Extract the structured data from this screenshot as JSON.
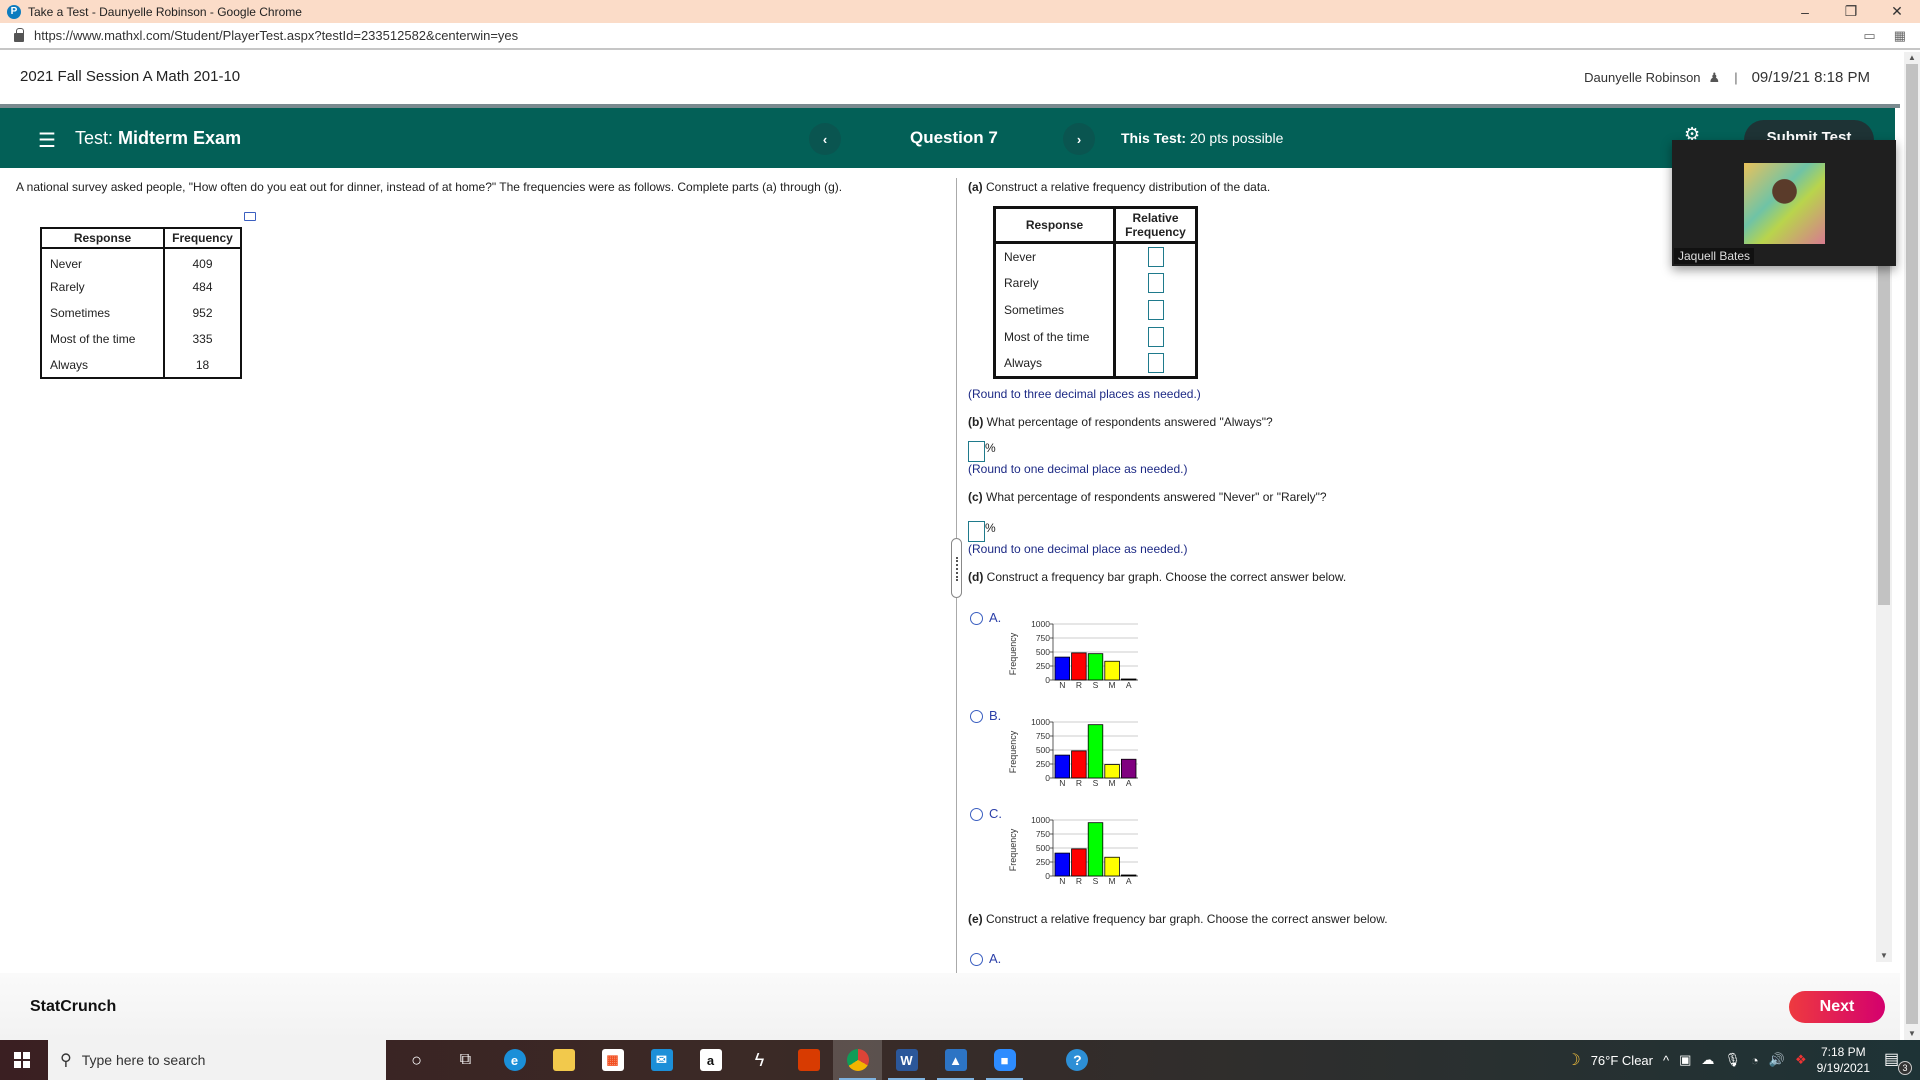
{
  "browser": {
    "window_title": "Take a Test - Daunyelle Robinson - Google Chrome",
    "url": "https://www.mathxl.com/Student/PlayerTest.aspx?testId=233512582&centerwin=yes",
    "controls": {
      "minimize": "–",
      "restore": "❐",
      "close": "✕"
    }
  },
  "header": {
    "course_title": "2021 Fall Session A Math 201-10",
    "user_name": "Daunyelle Robinson",
    "separator": "|",
    "datetime": "09/19/21 8:18 PM"
  },
  "testbar": {
    "menu_icon": "☰",
    "test_label": "Test:",
    "test_name": "Midterm Exam",
    "prev_icon": "‹",
    "question_label": "Question 7",
    "next_icon": "›",
    "points_label": "This Test:",
    "points_value": "20 pts possible",
    "settings_icon": "⚙",
    "submit_label": "Submit Test"
  },
  "problem": {
    "intro": "A national survey asked people, \"How often do you eat out for dinner, instead of at home?\" The frequencies were as follows. Complete parts (a) through (g).",
    "table": {
      "headers": [
        "Response",
        "Frequency"
      ],
      "rows": [
        {
          "response": "Never",
          "frequency": "409"
        },
        {
          "response": "Rarely",
          "frequency": "484"
        },
        {
          "response": "Sometimes",
          "frequency": "952"
        },
        {
          "response": "Most of the time",
          "frequency": "335"
        },
        {
          "response": "Always",
          "frequency": "18"
        }
      ]
    }
  },
  "parts": {
    "a": {
      "label": "(a)",
      "text": "Construct a relative frequency distribution of the data.",
      "headers": [
        "Response",
        "Relative",
        "Frequency"
      ],
      "rows": [
        "Never",
        "Rarely",
        "Sometimes",
        "Most of the time",
        "Always"
      ],
      "values": [
        "",
        "",
        "",
        "",
        ""
      ],
      "hint": "(Round to three decimal places as needed.)"
    },
    "b": {
      "label": "(b)",
      "text": "What percentage of respondents answered \"Always\"?",
      "value": "",
      "unit": "%",
      "hint": "(Round to one decimal place as needed.)"
    },
    "c": {
      "label": "(c)",
      "text": "What percentage of respondents answered \"Never\" or \"Rarely\"?",
      "value": "",
      "unit": "%",
      "hint": "(Round to one decimal place as needed.)"
    },
    "d": {
      "label": "(d)",
      "text": "Construct a frequency bar graph. Choose the correct answer below.",
      "options": [
        {
          "label": "A.",
          "selected": false
        },
        {
          "label": "B.",
          "selected": false
        },
        {
          "label": "C.",
          "selected": false
        }
      ]
    },
    "e": {
      "label": "(e)",
      "text": "Construct a relative frequency bar graph. Choose the correct answer below.",
      "options": [
        {
          "label": "A.",
          "selected": false
        }
      ]
    }
  },
  "chart_data": [
    {
      "type": "bar",
      "option": "A",
      "categories": [
        "N",
        "R",
        "S",
        "M",
        "A"
      ],
      "values": [
        409,
        484,
        470,
        335,
        18
      ],
      "colors": [
        "#0000ff",
        "#ff0000",
        "#00ff00",
        "#ffff00",
        "#000000"
      ],
      "ylabel": "Frequency",
      "yticks": [
        "0",
        "250",
        "500",
        "750",
        "1000"
      ],
      "ylim": [
        0,
        1000
      ],
      "grid": true
    },
    {
      "type": "bar",
      "option": "B",
      "categories": [
        "N",
        "R",
        "S",
        "M",
        "A"
      ],
      "values": [
        409,
        484,
        952,
        240,
        335
      ],
      "colors": [
        "#0000ff",
        "#ff0000",
        "#00ff00",
        "#ffff00",
        "#800080"
      ],
      "ylabel": "Frequency",
      "yticks": [
        "0",
        "250",
        "500",
        "750",
        "1000"
      ],
      "ylim": [
        0,
        1000
      ],
      "grid": true
    },
    {
      "type": "bar",
      "option": "C",
      "categories": [
        "N",
        "R",
        "S",
        "M",
        "A"
      ],
      "values": [
        409,
        484,
        952,
        335,
        18
      ],
      "colors": [
        "#0000ff",
        "#ff0000",
        "#00ff00",
        "#ffff00",
        "#000000"
      ],
      "ylabel": "Frequency",
      "yticks": [
        "0",
        "250",
        "500",
        "750",
        "1000"
      ],
      "ylim": [
        0,
        1000
      ],
      "grid": true
    }
  ],
  "footer": {
    "statcrunch_label": "StatCrunch",
    "next_label": "Next"
  },
  "video": {
    "participant_name": "Jaquell Bates"
  },
  "taskbar": {
    "search_placeholder": "Type here to search",
    "weather": "76°F  Clear",
    "time": "7:18 PM",
    "date": "9/19/2021",
    "notification_count": "3"
  },
  "colors": {
    "testbar": "#036057",
    "accent_next": "#e0205a",
    "hint_text": "#1d2a85",
    "input_border": "#1f7a8c"
  }
}
